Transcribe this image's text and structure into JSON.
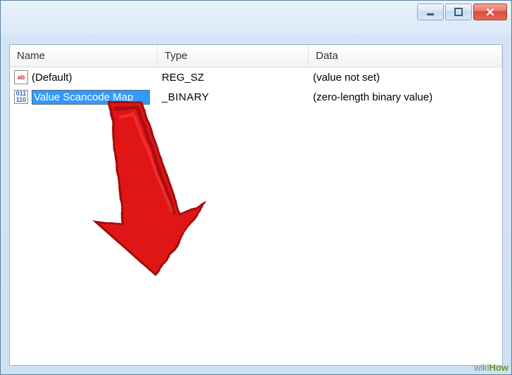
{
  "columns": {
    "name": "Name",
    "type": "Type",
    "data": "Data"
  },
  "rows": [
    {
      "icon": "ab",
      "name": "(Default)",
      "type": "REG_SZ",
      "data": "(value not set)"
    },
    {
      "icon": "01\n10",
      "name_editing": "Value Scancode Map",
      "type_visible": "_BINARY",
      "data": "(zero-length binary value)"
    }
  ],
  "watermark": {
    "prefix": "wiki",
    "suffix": "How"
  }
}
